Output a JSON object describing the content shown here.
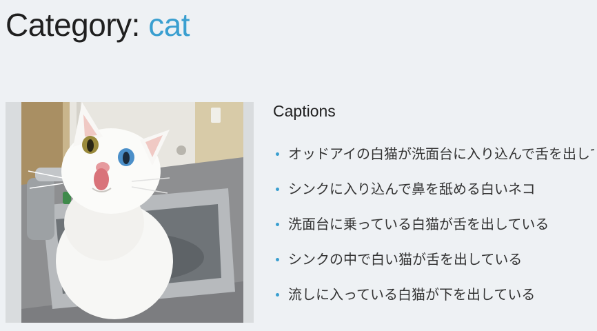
{
  "header": {
    "prefix": "Category:",
    "category": "cat"
  },
  "image": {
    "subject": "white cat in kitchen sink"
  },
  "captions": {
    "title": "Captions",
    "items": [
      "オッドアイの白猫が洗面台に入り込んで舌を出している",
      "シンクに入り込んで鼻を舐める白いネコ",
      "洗面台に乗っている白猫が舌を出している",
      "シンクの中で白い猫が舌を出している",
      "流しに入っている白猫が下を出している"
    ]
  },
  "colors": {
    "background": "#eef1f4",
    "link": "#3a9fd0",
    "bullet": "#3a9fd0"
  }
}
